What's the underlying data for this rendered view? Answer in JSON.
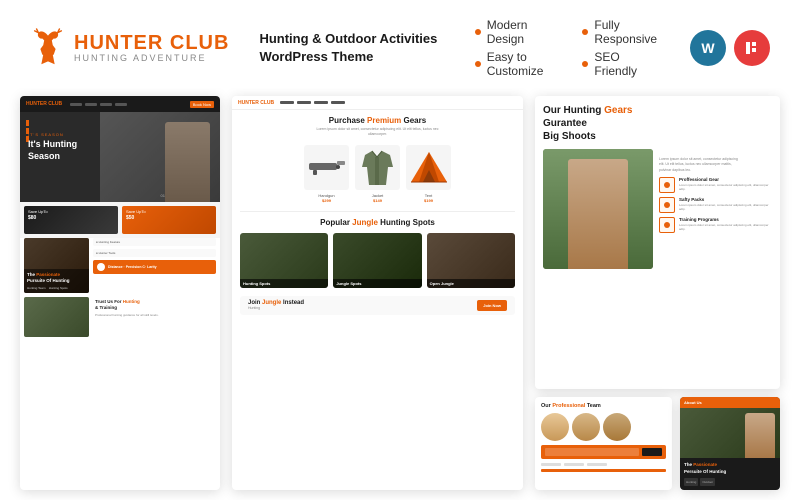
{
  "header": {
    "logo": {
      "brand": "HUNTER",
      "brand2": " CLUB",
      "tagline": "Hunting Adventure"
    },
    "product_title": "Hunting & Outdoor Activities\nWordPress Theme",
    "features": [
      {
        "label": "Modern Design"
      },
      {
        "label": "Fully Responsive"
      },
      {
        "label": "Easy to Customize"
      },
      {
        "label": "SEO Friendly"
      }
    ],
    "badges": {
      "wp": "W",
      "elementor": "e"
    }
  },
  "preview_left": {
    "nav_logo": "HUNTER CLUB",
    "hero": {
      "season_label": "IT'S SEASON",
      "title": "It's Hunting\nSeason",
      "slide_num": "01"
    },
    "promo": {
      "card1_label": "Save UpTo",
      "card1_amount": "$80",
      "card2_label": "Save UpTo",
      "card2_amount": "$50"
    },
    "hunting_section": {
      "title": "The Passionate",
      "title2": "Pursuite Of Hunting",
      "orange_word": "Passionate"
    },
    "precision": "Distance · Percision C· Larity",
    "trust": {
      "title": "Trust Us For Hunting\n& Training",
      "orange_word": "Hunting"
    }
  },
  "preview_middle": {
    "gear_section": {
      "title": "Purchase Premium Gears",
      "orange_word": "Premium",
      "desc": "Lorem ipsum dolor sit amet, consectetur adipiscing elit. Ut elit tellus."
    },
    "gear_items": [
      {
        "label": "Handgun",
        "price": "$299"
      },
      {
        "label": "Jacket",
        "price": "$149"
      },
      {
        "label": "Tent",
        "price": "$199"
      }
    ],
    "jungle_section": {
      "title": "Popular Jungle Hunting Spots",
      "orange_word": "Jungle",
      "spots": [
        {
          "label": "Hunting Spots"
        },
        {
          "label": "Jungle Spots"
        },
        {
          "label": "Open Jungle"
        }
      ]
    },
    "join_section": {
      "title": "Join Jungle Instead",
      "title2": "Hunting",
      "orange_word": "Jungle",
      "btn": "Join Now"
    }
  },
  "preview_right": {
    "top": {
      "title": "Our Hunting Gears Gurantee",
      "title2": "Big Shoots",
      "orange_word": "Gears",
      "desc": "Lorem ipsum dolor sit amet, consectetur adipiscing elit. Ut elit tellus, luctus nec ullamcorper mattis, pulvinar dapibus leo. Lorem ipsum dolor sit amet.",
      "features": [
        {
          "name": "Proffessional Gear",
          "desc": "Lorem ipsum dolor sit amet, consectetur adipiscing elit, ullamcorper adip."
        },
        {
          "name": "Safty Packs",
          "desc": "Lorem ipsum dolor sit amet, consectetur adipiscing elit, ullamcorper adip."
        },
        {
          "name": "Training Programs",
          "desc": "Lorem ipsum dolor sit amet, consectetur adipiscing elit, ullamcorper adip."
        }
      ]
    },
    "team": {
      "title": "Our Professional Team",
      "orange_word": "Professional",
      "newsletter_placeholder": "Subscribe Newsletter"
    },
    "about": {
      "nav": "About Us",
      "title": "The Passionate\nPersuite Of Hunting",
      "orange_word": "Passionate"
    }
  }
}
